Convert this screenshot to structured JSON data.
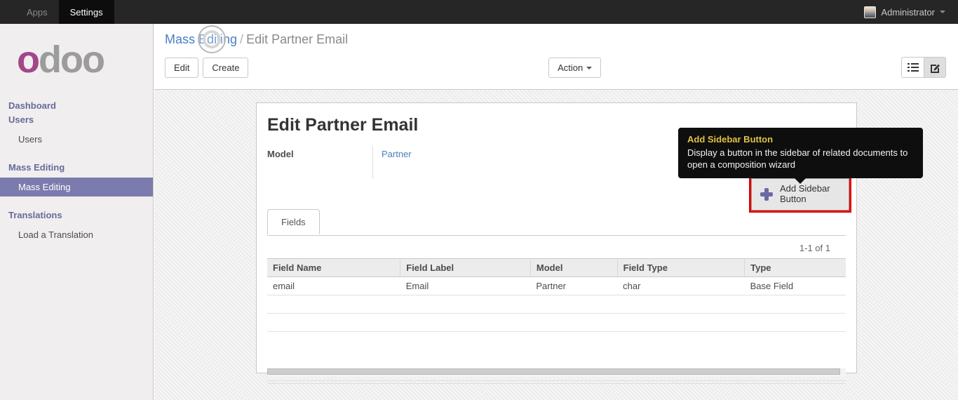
{
  "topbar": {
    "apps_label": "Apps",
    "settings_label": "Settings",
    "user_name": "Administrator"
  },
  "sidebar": {
    "logo_first": "o",
    "logo_rest": "doo",
    "headers": [
      "Dashboard",
      "Users",
      "Mass Editing",
      "Translations"
    ],
    "items": [
      {
        "label": "Users",
        "active": false
      },
      {
        "label": "Mass Editing",
        "active": true
      },
      {
        "label": "Load a Translation",
        "active": false
      }
    ]
  },
  "control_panel": {
    "breadcrumb_link": "Mass Editing",
    "breadcrumb_separator": "/",
    "breadcrumb_current": "Edit Partner Email",
    "edit_label": "Edit",
    "create_label": "Create",
    "action_label": "Action",
    "view_switcher": [
      "list-view",
      "form-view"
    ],
    "active_view": "form-view"
  },
  "sheet": {
    "title": "Edit Partner Email",
    "model_label": "Model",
    "model_value": "Partner",
    "add_sidebar_button_label": "Add Sidebar Button",
    "tab_label": "Fields",
    "pager": "1-1 of 1",
    "table": {
      "headers": [
        "Field Name",
        "Field Label",
        "Model",
        "Field Type",
        "Type"
      ],
      "rows": [
        [
          "email",
          "Email",
          "Partner",
          "char",
          "Base Field"
        ]
      ]
    }
  },
  "tooltip": {
    "title": "Add Sidebar Button",
    "body": "Display a button in the sidebar of related documents to open a composition wizard"
  },
  "icons": {
    "plus": "plus-icon",
    "list_view": "list-icon",
    "form_view": "form-edit-icon",
    "caret": "caret-down-icon",
    "spinner": "loading-spinner-icon"
  },
  "colors": {
    "accent_purple": "#7b7bad",
    "logo_magenta": "#a24689",
    "link_blue": "#4a7fc1",
    "highlight_red": "#e60000",
    "tooltip_title_gold": "#dfc340",
    "topbar_bg": "#262626",
    "sidebar_bg": "#f0eeee"
  }
}
